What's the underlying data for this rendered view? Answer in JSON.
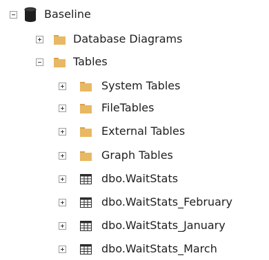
{
  "tree": {
    "root": {
      "label": "Baseline",
      "icon": "database-icon",
      "expander": "collapse"
    },
    "level1": [
      {
        "label": "Database Diagrams",
        "icon": "folder-icon",
        "expander": "expand"
      },
      {
        "label": "Tables",
        "icon": "folder-icon",
        "expander": "collapse"
      }
    ],
    "tables_children": [
      {
        "label": "System Tables",
        "icon": "folder-icon",
        "expander": "expand"
      },
      {
        "label": "FileTables",
        "icon": "folder-icon",
        "expander": "expand"
      },
      {
        "label": "External Tables",
        "icon": "folder-icon",
        "expander": "expand"
      },
      {
        "label": "Graph Tables",
        "icon": "folder-icon",
        "expander": "expand"
      },
      {
        "label": "dbo.WaitStats",
        "icon": "table-icon",
        "expander": "expand"
      },
      {
        "label": "dbo.WaitStats_February",
        "icon": "table-icon",
        "expander": "expand"
      },
      {
        "label": "dbo.WaitStats_January",
        "icon": "table-icon",
        "expander": "expand"
      },
      {
        "label": "dbo.WaitStats_March",
        "icon": "table-icon",
        "expander": "expand"
      }
    ]
  },
  "colors": {
    "folder": "#e8b863",
    "folder_tab": "#d9a24a",
    "table_grid": "#2b2b2b",
    "database": "#1f1f1f",
    "expander_border": "#9a9a9a",
    "text": "#1e1e1e"
  }
}
